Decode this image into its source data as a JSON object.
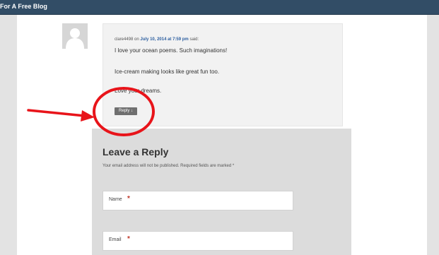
{
  "topbar": {
    "title": "For A Free Blog"
  },
  "comment": {
    "author": "clare4498",
    "on_text": "on",
    "date": "July 10, 2014 at 7:59 pm",
    "said_text": "said:",
    "lines": [
      "I love your ocean poems. Such imaginations!",
      "Ice-cream making looks like great fun too.",
      "Love your dreams."
    ],
    "reply_label": "Reply ↓"
  },
  "reply_form": {
    "heading": "Leave a Reply",
    "notes": "Your email address will not be published. Required fields are marked *",
    "fields": [
      {
        "label": "Name",
        "required_mark": "*",
        "value": ""
      },
      {
        "label": "Email",
        "required_mark": "*",
        "value": ""
      }
    ]
  },
  "colors": {
    "topbar": "#324d66",
    "link": "#2d5fa0",
    "reply_button": "#6f6f6f",
    "required": "#c0392b",
    "annotation": "#e8141a"
  },
  "icons": {
    "avatar": "default-person-silhouette"
  }
}
